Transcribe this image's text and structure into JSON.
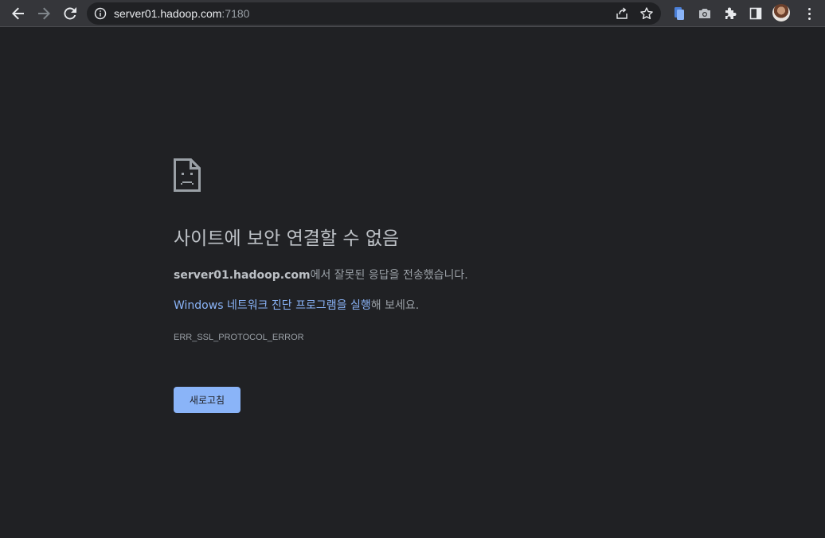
{
  "browser": {
    "url_host": "server01.hadoop.com",
    "url_port": ":7180",
    "icons": {
      "back": "arrow-left-icon",
      "forward": "arrow-right-icon",
      "reload": "reload-icon",
      "site_info": "info-icon",
      "share": "share-icon",
      "bookmark": "star-icon",
      "extension_1": "document-icon",
      "extension_2": "camera-icon",
      "extensions": "puzzle-icon",
      "side_panel": "side-panel-icon",
      "menu": "more-vert-icon"
    }
  },
  "error_page": {
    "icon": "sad-page-icon",
    "title": "사이트에 보안 연결할 수 없음",
    "description_host": "server01.hadoop.com",
    "description_rest": "에서 잘못된 응답을 전송했습니다.",
    "suggestion_link": "Windows 네트워크 진단 프로그램을 실행",
    "suggestion_rest": "해 보세요.",
    "error_code": "ERR_SSL_PROTOCOL_ERROR",
    "reload_label": "새로고침"
  },
  "colors": {
    "page_background": "#202124",
    "toolbar_background": "#35363a",
    "link": "#8ab4f8",
    "button": "#8ab4f8",
    "title_text": "#bdc1c6",
    "body_text": "#9aa0a6"
  }
}
